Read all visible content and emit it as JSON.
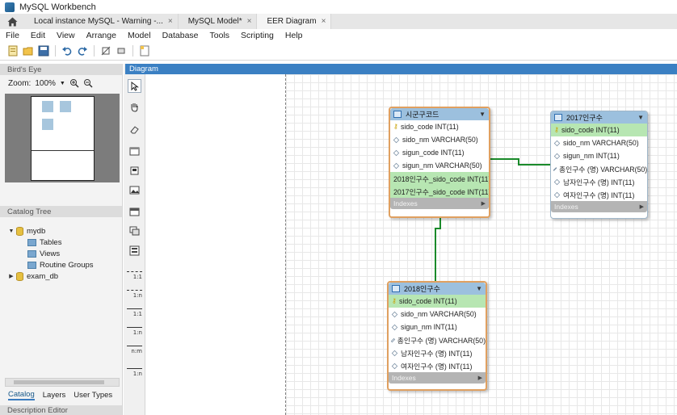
{
  "window": {
    "title": "MySQL Workbench"
  },
  "tabs": [
    {
      "label": "Local instance MySQL - Warning -...",
      "close": "×"
    },
    {
      "label": "MySQL Model*",
      "close": "×"
    },
    {
      "label": "EER Diagram",
      "close": "×"
    }
  ],
  "menu": [
    "File",
    "Edit",
    "View",
    "Arrange",
    "Model",
    "Database",
    "Tools",
    "Scripting",
    "Help"
  ],
  "toolbar_icons": [
    "new-file-icon",
    "open-folder-icon",
    "save-icon",
    "undo-icon",
    "redo-icon",
    "toggle-grid-icon",
    "align-icon",
    "new-diagram-icon"
  ],
  "birds_eye": {
    "header": "Bird's Eye",
    "zoom_label": "Zoom:",
    "zoom_value": "100%"
  },
  "catalog": {
    "header": "Catalog Tree",
    "schemas": [
      {
        "name": "mydb",
        "expanded": true,
        "children": [
          "Tables",
          "Views",
          "Routine Groups"
        ]
      },
      {
        "name": "exam_db",
        "expanded": false,
        "children": []
      }
    ]
  },
  "bottom_tabs": [
    "Catalog",
    "Layers",
    "User Types"
  ],
  "description_header": "Description Editor",
  "diagram": {
    "header": "Diagram"
  },
  "relationship_tools": [
    "1:1",
    "1:n",
    "1:1",
    "1:n",
    "n:m",
    "1:n"
  ],
  "entities": [
    {
      "name": "시군구코드",
      "selected": true,
      "columns": [
        {
          "text": "sido_code INT(11)",
          "kind": "pk",
          "highlight": false
        },
        {
          "text": "sido_nm VARCHAR(50)",
          "kind": "col",
          "highlight": false
        },
        {
          "text": "sigun_code INT(11)",
          "kind": "col",
          "highlight": false
        },
        {
          "text": "sigun_nm VARCHAR(50)",
          "kind": "col",
          "highlight": false
        },
        {
          "text": "2018인구수_sido_code INT(11)",
          "kind": "fk",
          "highlight": true
        },
        {
          "text": "2017인구수_sido_code INT(11)",
          "kind": "fk",
          "highlight": true
        }
      ],
      "indexes_label": "Indexes"
    },
    {
      "name": "2017인구수",
      "selected": false,
      "columns": [
        {
          "text": "sido_code INT(11)",
          "kind": "pk",
          "highlight": true
        },
        {
          "text": "sido_nm VARCHAR(50)",
          "kind": "col",
          "highlight": false
        },
        {
          "text": "sigun_nm INT(11)",
          "kind": "col",
          "highlight": false
        },
        {
          "text": "총인구수 (명) VARCHAR(50)",
          "kind": "col",
          "highlight": false
        },
        {
          "text": "남자인구수 (명) INT(11)",
          "kind": "col",
          "highlight": false
        },
        {
          "text": "여자인구수 (명) INT(11)",
          "kind": "col",
          "highlight": false
        }
      ],
      "indexes_label": "Indexes"
    },
    {
      "name": "2018인구수",
      "selected": true,
      "columns": [
        {
          "text": "sido_code INT(11)",
          "kind": "pk",
          "highlight": true
        },
        {
          "text": "sido_nm VARCHAR(50)",
          "kind": "col",
          "highlight": false
        },
        {
          "text": "sigun_nm INT(11)",
          "kind": "col",
          "highlight": false
        },
        {
          "text": "총인구수 (명) VARCHAR(50)",
          "kind": "col",
          "highlight": false
        },
        {
          "text": "남자인구수 (명) INT(11)",
          "kind": "col",
          "highlight": false
        },
        {
          "text": "여자인구수 (명) INT(11)",
          "kind": "col",
          "highlight": false
        }
      ],
      "indexes_label": "Indexes"
    }
  ],
  "colors": {
    "accent": "#3b80c3",
    "relationship": "#1a8a2a",
    "highlight_row": "#b7e6b2",
    "table_header": "#9cc0de",
    "selected_border": "#e0a060"
  }
}
